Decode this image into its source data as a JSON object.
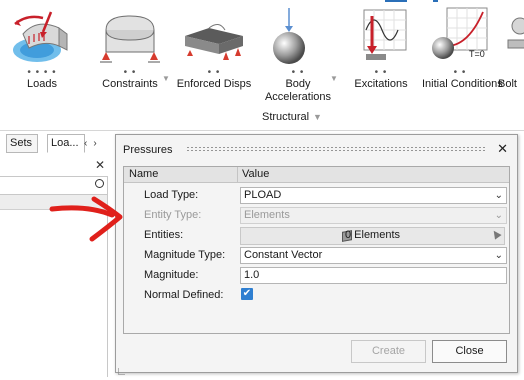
{
  "ribbon": {
    "tools": [
      {
        "label": "Loads",
        "dots": "• • • •",
        "icon": "loads-pressure-icon"
      },
      {
        "label": "Constraints",
        "dots": "• •",
        "icon": "constraints-icon"
      },
      {
        "label": "Enforced Disps",
        "dots": "• •",
        "icon": "enforced-disps-icon"
      },
      {
        "label": "Body\nAccelerations",
        "dots": "• •",
        "icon": "body-accelerations-icon"
      },
      {
        "label": "Excitations",
        "dots": "• •",
        "icon": "excitations-icon"
      },
      {
        "label": "Initial Conditions",
        "dots": "• •",
        "icon": "initial-conditions-icon"
      },
      {
        "label": "Bolt",
        "dots": "",
        "icon": "bolt-icon"
      }
    ],
    "group_label": "Structural",
    "initial_conditions_icon_text": "T=0",
    "accent_color": "#2a6fb8"
  },
  "left_panel": {
    "tabs": [
      "Sets",
      "Loa..."
    ],
    "arrow_left": "‹",
    "arrow_right": "›",
    "close_glyph": "✕"
  },
  "dialog": {
    "title": "Pressures",
    "close_glyph": "✕",
    "columns": {
      "name": "Name",
      "value": "Value"
    },
    "rows": [
      {
        "label": "Load Type:",
        "value": "PLOAD",
        "kind": "select",
        "enabled": true
      },
      {
        "label": "Entity Type:",
        "value": "Elements",
        "kind": "select",
        "enabled": false
      },
      {
        "label": "Entities:",
        "value": "0 Elements",
        "kind": "entity-picker",
        "enabled": true
      },
      {
        "label": "Magnitude Type:",
        "value": "Constant Vector",
        "kind": "select",
        "enabled": true
      },
      {
        "label": "Magnitude:",
        "value": "1.0",
        "kind": "text",
        "enabled": true
      },
      {
        "label": "Normal Defined:",
        "value": "✔",
        "kind": "checkbox",
        "checked": true
      }
    ],
    "buttons": {
      "create": "Create",
      "close": "Close"
    },
    "checkbox_color": "#2f7fd1"
  },
  "annotation": {
    "arrow_color": "#e0201b"
  }
}
